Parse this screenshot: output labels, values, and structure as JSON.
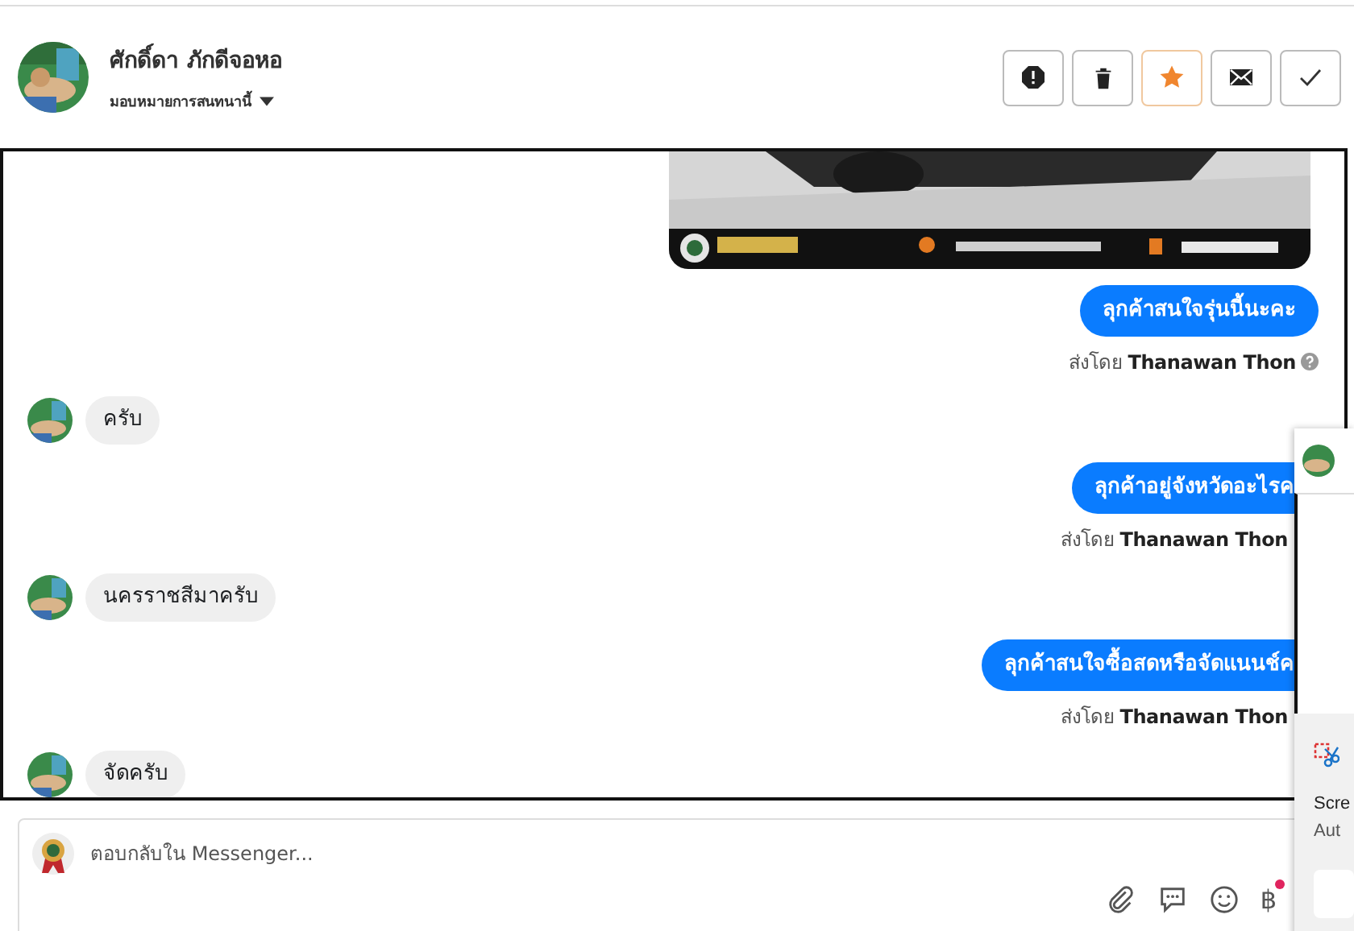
{
  "header": {
    "name": "ศักดิ์ดา ภักดีจอหอ",
    "assign_label": "มอบหมายการสนทนานี้",
    "actions": [
      {
        "kind": "report",
        "active": false
      },
      {
        "kind": "delete",
        "active": false
      },
      {
        "kind": "star",
        "active": true
      },
      {
        "kind": "mail",
        "active": false
      },
      {
        "kind": "done",
        "active": false
      }
    ]
  },
  "messages": [
    {
      "kind": "picture"
    },
    {
      "kind": "outgoing",
      "text": "ลุกค้าสนใจรุ่นนี้นะคะ",
      "sent_prefix": "ส่งโดย",
      "sender": "Thanawan Thon",
      "help_icon": true
    },
    {
      "kind": "incoming",
      "text": "ครับ"
    },
    {
      "kind": "outgoing",
      "text": "ลุกค้าอยู่จังหวัดอะไรค",
      "sent_prefix": "ส่งโดย",
      "sender": "Thanawan Thon"
    },
    {
      "kind": "incoming",
      "text": "นครราชสีมาครับ"
    },
    {
      "kind": "outgoing",
      "text": "ลุกค้าสนใจซื้อสดหรือจัดแนนช์ค",
      "sent_prefix": "ส่งโดย",
      "sender": "Thanawan Thon"
    },
    {
      "kind": "incoming",
      "text": "จัดครับ"
    }
  ],
  "composer": {
    "placeholder": "ตอบกลับใน Messenger...",
    "currency_symbol": "฿",
    "notification_dot": true
  },
  "overlay": {
    "lines": [
      "Scre",
      "Aut"
    ]
  }
}
